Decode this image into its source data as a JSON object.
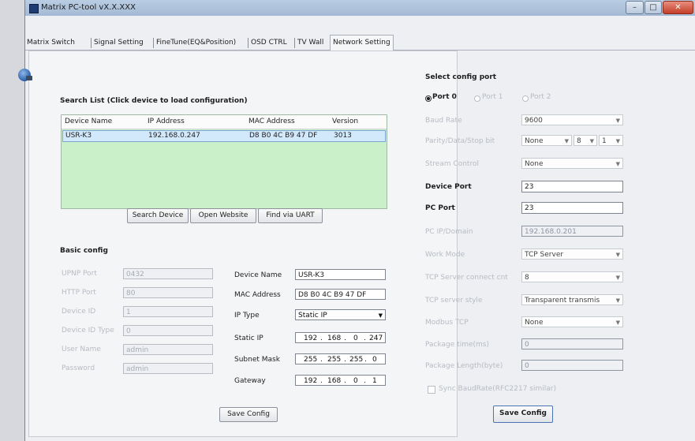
{
  "window": {
    "title": "Matrix PC-tool vX.X.XXX",
    "controls": {
      "minimize": "–",
      "maximize": "□",
      "close": "✕"
    }
  },
  "tabs": [
    "Matrix Switch",
    "Signal Setting",
    "FineTune(EQ&Position)",
    "OSD CTRL",
    "TV Wall",
    "Network Setting"
  ],
  "active_tab": "Network Setting",
  "search": {
    "title": "Search List (Click device to load configuration)",
    "columns": [
      "Device Name",
      "IP Address",
      "MAC Address",
      "Version"
    ],
    "rows": [
      {
        "name": "USR-K3",
        "ip": "192.168.0.247",
        "mac": "D8 B0 4C B9 47 DF",
        "version": "3013"
      }
    ],
    "buttons": {
      "search": "Search Device",
      "website": "Open Website",
      "uart": "Find via UART"
    }
  },
  "basic": {
    "title": "Basic config",
    "left": [
      {
        "label": "UPNP Port",
        "value": "0432"
      },
      {
        "label": "HTTP Port",
        "value": "80"
      },
      {
        "label": "Device ID",
        "value": "1"
      },
      {
        "label": "Device ID Type",
        "value": "0"
      },
      {
        "label": "User Name",
        "value": "admin"
      },
      {
        "label": "Password",
        "value": "admin"
      }
    ],
    "device_name": {
      "label": "Device Name",
      "value": "USR-K3"
    },
    "mac": {
      "label": "MAC Address",
      "value": "D8 B0 4C B9 47 DF"
    },
    "ip_type": {
      "label": "IP Type",
      "value": "Static IP"
    },
    "static_ip": {
      "label": "Static IP",
      "octets": [
        "192",
        "168",
        "0",
        "247"
      ]
    },
    "subnet": {
      "label": "Subnet Mask",
      "octets": [
        "255",
        "255",
        "255",
        "0"
      ]
    },
    "gateway": {
      "label": "Gateway",
      "octets": [
        "192",
        "168",
        "0",
        "1"
      ]
    },
    "save_label": "Save Config"
  },
  "port": {
    "title": "Select config port",
    "options": [
      "Port 0",
      "Port 1",
      "Port 2"
    ],
    "selected": "Port 0",
    "rows": [
      {
        "label": "Baud Rate",
        "value": "9600"
      },
      {
        "label": "Parity/Data/Stop bit",
        "values": [
          "None",
          "8",
          "1"
        ]
      },
      {
        "label": "Stream Control",
        "value": "None"
      },
      {
        "label": "Device Port",
        "value": "23"
      },
      {
        "label": "PC Port",
        "value": "23"
      },
      {
        "label": "PC IP/Domain",
        "value": "192.168.0.201"
      },
      {
        "label": "Work Mode",
        "value": "TCP Server"
      },
      {
        "label": "TCP Server connect cnt",
        "value": "8"
      },
      {
        "label": "TCP server style",
        "value": "Transparent transmis"
      },
      {
        "label": "Modbus TCP",
        "value": "None"
      },
      {
        "label": "Package time(ms)",
        "value": "0"
      },
      {
        "label": "Package Length(byte)",
        "value": "0"
      }
    ],
    "sync_label": "Sync BaudRate(RFC2217 similar)",
    "save_label": "Save Config"
  }
}
